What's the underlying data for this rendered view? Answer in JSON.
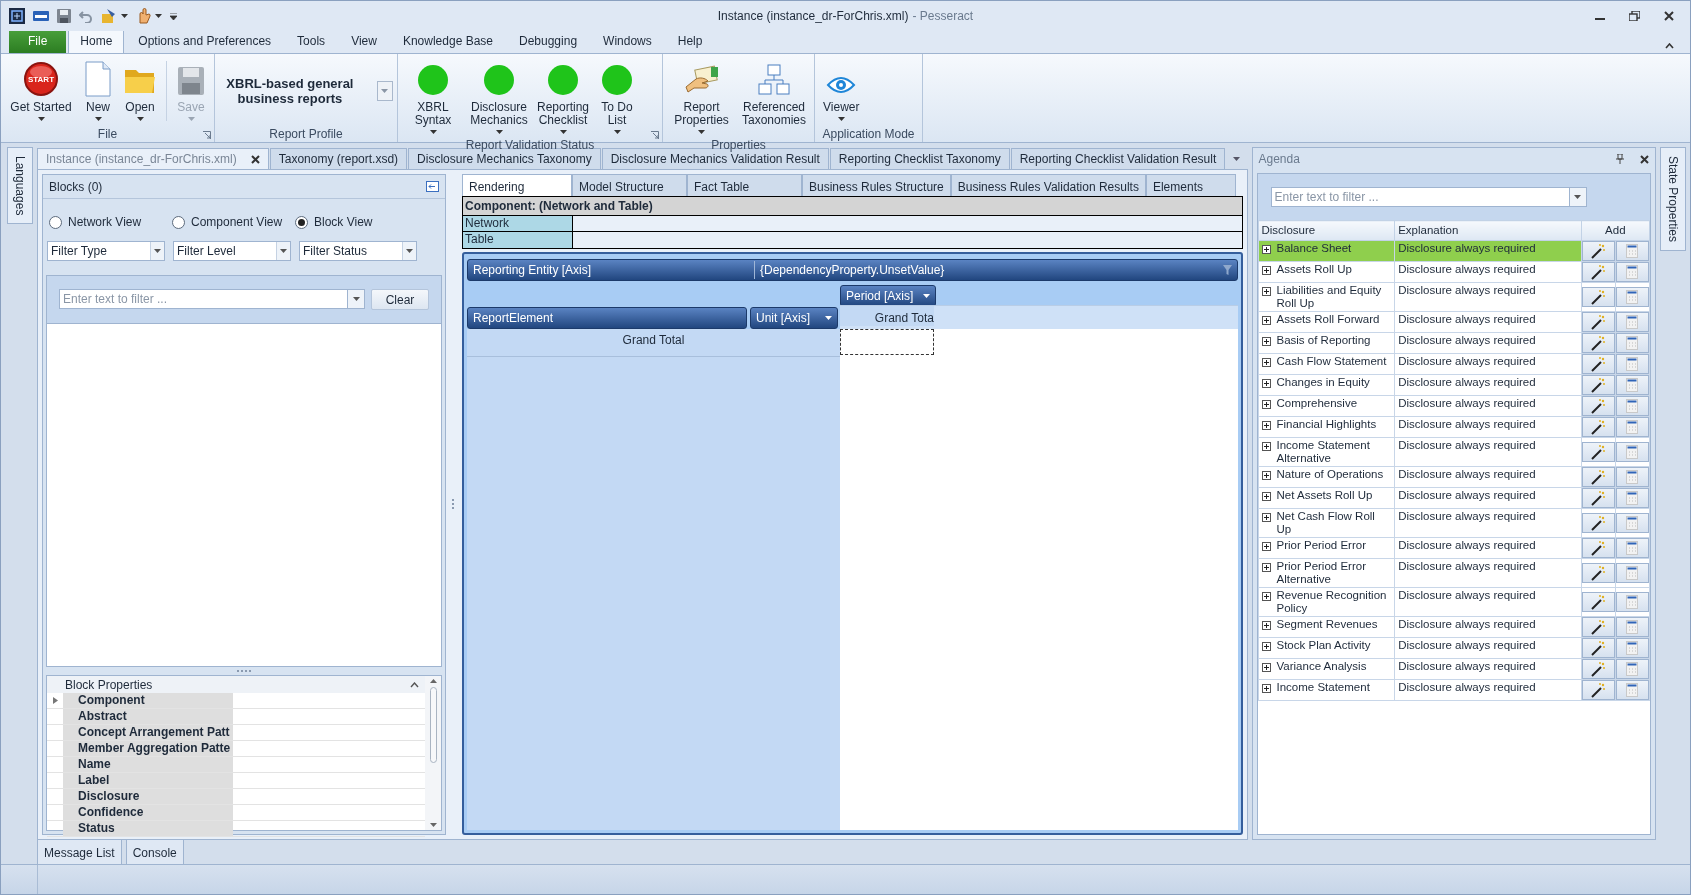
{
  "window": {
    "title": "Instance (instance_dr-ForChris.xml)",
    "app_suffix": "- Pesseract"
  },
  "ribbon_tabs": [
    {
      "label": "File",
      "kind": "file",
      "selected": false
    },
    {
      "label": "Home",
      "kind": "tab",
      "selected": true
    },
    {
      "label": "Options and Preferences",
      "kind": "tab",
      "selected": false
    },
    {
      "label": "Tools",
      "kind": "tab",
      "selected": false
    },
    {
      "label": "View",
      "kind": "tab",
      "selected": false
    },
    {
      "label": "Knowledge Base",
      "kind": "tab",
      "selected": false
    },
    {
      "label": "Debugging",
      "kind": "tab",
      "selected": false
    },
    {
      "label": "Windows",
      "kind": "tab",
      "selected": false
    },
    {
      "label": "Help",
      "kind": "tab",
      "selected": false
    }
  ],
  "ribbon_groups": [
    {
      "label": "File",
      "launcher": true,
      "kind": "buttons",
      "buttons": [
        {
          "label": "Get Started",
          "icon_text": "START",
          "dropdown": true,
          "disabled": false
        },
        {
          "label": "New",
          "dropdown": true,
          "disabled": false
        },
        {
          "label": "Open",
          "dropdown": true,
          "disabled": false
        },
        {
          "label": "Save",
          "dropdown": true,
          "disabled": true
        }
      ]
    },
    {
      "label": "Report Profile",
      "kind": "profile",
      "value": "XBRL-based general business reports"
    },
    {
      "label": "Report Validation Status",
      "launcher": true,
      "kind": "buttons",
      "buttons": [
        {
          "label": "XBRL Syntax",
          "color": "#1fc41a",
          "dropdown": true,
          "disabled": false
        },
        {
          "label": "Disclosure Mechanics",
          "color": "#1fc41a",
          "dropdown": true,
          "disabled": false
        },
        {
          "label": "Reporting Checklist",
          "color": "#1fc41a",
          "dropdown": true,
          "disabled": false
        },
        {
          "label": "To Do List",
          "color": "#1fc41a",
          "dropdown": true,
          "disabled": false
        }
      ]
    },
    {
      "label": "Properties",
      "kind": "buttons",
      "buttons": [
        {
          "label": "Report Properties",
          "dropdown": true,
          "disabled": false
        },
        {
          "label": "Referenced Taxonomies",
          "disabled": false
        }
      ]
    },
    {
      "label": "Application Mode",
      "kind": "buttons",
      "buttons": [
        {
          "label": "Viewer",
          "dropdown": true,
          "disabled": false
        }
      ]
    }
  ],
  "left_strip": {
    "label": "Languages"
  },
  "document_tabs": [
    {
      "label": "Instance (instance_dr-ForChris.xml)",
      "selected": true,
      "closable": true
    },
    {
      "label": "Taxonomy (report.xsd)",
      "selected": false
    },
    {
      "label": "Disclosure Mechanics Taxonomy",
      "selected": false
    },
    {
      "label": "Disclosure Mechanics Validation Result",
      "selected": false
    },
    {
      "label": "Reporting Checklist Taxonomy",
      "selected": false
    },
    {
      "label": "Reporting Checklist Validation Result",
      "selected": false
    }
  ],
  "blocks_panel": {
    "title": "Blocks (0)",
    "views": [
      {
        "label": "Network View",
        "selected": false
      },
      {
        "label": "Component View",
        "selected": false
      },
      {
        "label": "Block View",
        "selected": true
      }
    ],
    "filters": [
      {
        "value": "Filter Type"
      },
      {
        "value": "Filter Level"
      },
      {
        "value": "Filter Status"
      }
    ],
    "search": {
      "placeholder": "Enter text to filter ..."
    },
    "clear_button": "Clear",
    "properties": {
      "title": "Block Properties",
      "rows": [
        {
          "name": "Component",
          "expandable": true
        },
        {
          "name": "Abstract"
        },
        {
          "name": "Concept Arrangement Patt"
        },
        {
          "name": "Member Aggregation Patte"
        },
        {
          "name": "Name"
        },
        {
          "name": "Label"
        },
        {
          "name": "Disclosure"
        },
        {
          "name": "Confidence"
        },
        {
          "name": "Status"
        }
      ]
    }
  },
  "view_tabs": [
    {
      "label": "Rendering",
      "selected": true
    },
    {
      "label": "Model Structure",
      "selected": false
    },
    {
      "label": "Fact Table",
      "selected": false
    },
    {
      "label": "Business Rules Structure",
      "selected": false
    },
    {
      "label": "Business Rules Validation Results",
      "selected": false
    },
    {
      "label": "Elements",
      "selected": false
    }
  ],
  "component": {
    "title": "Component: (Network and Table)",
    "rows": [
      {
        "label": "Network"
      },
      {
        "label": "Table"
      }
    ]
  },
  "pivot": {
    "filter_field": "Reporting Entity [Axis]",
    "filter_value": "{DependencyProperty.UnsetValue}",
    "column_field": "Period [Axis]",
    "row_fields": [
      "ReportElement",
      "Unit [Axis]"
    ],
    "column_total": "Grand Tota",
    "row_total": "Grand Total"
  },
  "agenda": {
    "title": "Agenda",
    "search": {
      "placeholder": "Enter text to filter ..."
    },
    "columns": [
      "Disclosure",
      "Explanation",
      "Add"
    ],
    "rows": [
      {
        "disclosure": "Balance Sheet",
        "explanation": "Disclosure always required",
        "selected": true
      },
      {
        "disclosure": "Assets Roll Up",
        "explanation": "Disclosure always required",
        "selected": false
      },
      {
        "disclosure": "Liabilities and Equity Roll Up",
        "explanation": "Disclosure always required",
        "selected": false
      },
      {
        "disclosure": "Assets Roll Forward",
        "explanation": "Disclosure always required",
        "selected": false
      },
      {
        "disclosure": "Basis of Reporting",
        "explanation": "Disclosure always required",
        "selected": false
      },
      {
        "disclosure": "Cash Flow Statement",
        "explanation": "Disclosure always required",
        "selected": false
      },
      {
        "disclosure": "Changes in Equity",
        "explanation": "Disclosure always required",
        "selected": false
      },
      {
        "disclosure": "Comprehensive",
        "explanation": "Disclosure always required",
        "selected": false
      },
      {
        "disclosure": "Financial Highlights",
        "explanation": "Disclosure always required",
        "selected": false
      },
      {
        "disclosure": "Income Statement Alternative",
        "explanation": "Disclosure always required",
        "selected": false
      },
      {
        "disclosure": "Nature of Operations",
        "explanation": "Disclosure always required",
        "selected": false
      },
      {
        "disclosure": "Net Assets Roll Up",
        "explanation": "Disclosure always required",
        "selected": false
      },
      {
        "disclosure": "Net Cash Flow Roll Up",
        "explanation": "Disclosure always required",
        "selected": false
      },
      {
        "disclosure": "Prior Period Error",
        "explanation": "Disclosure always required",
        "selected": false
      },
      {
        "disclosure": "Prior Period Error Alternative",
        "explanation": "Disclosure always required",
        "selected": false
      },
      {
        "disclosure": "Revenue Recognition Policy",
        "explanation": "Disclosure always required",
        "selected": false
      },
      {
        "disclosure": "Segment Revenues",
        "explanation": "Disclosure always required",
        "selected": false
      },
      {
        "disclosure": "Stock Plan Activity",
        "explanation": "Disclosure always required",
        "selected": false
      },
      {
        "disclosure": "Variance Analysis",
        "explanation": "Disclosure always required",
        "selected": false
      },
      {
        "disclosure": "Income Statement",
        "explanation": "Disclosure always required",
        "selected": false
      }
    ]
  },
  "right_strip": {
    "label": "State Properties"
  },
  "bottom_tabs": [
    {
      "label": "Message List"
    },
    {
      "label": "Console"
    }
  ]
}
